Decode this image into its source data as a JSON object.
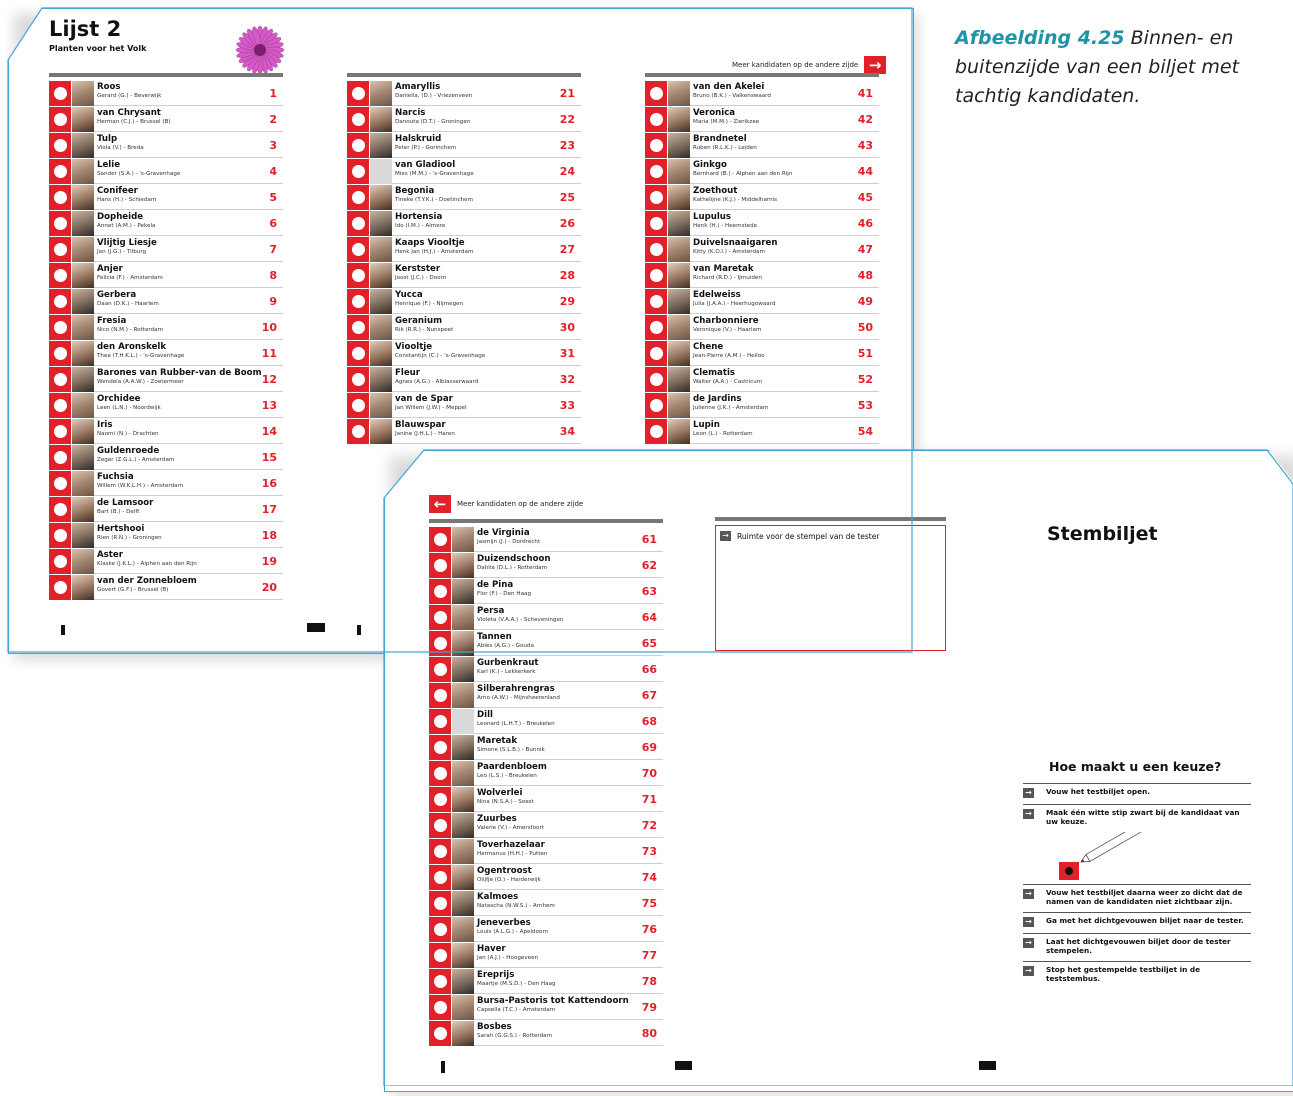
{
  "caption": {
    "label": "Afbeelding 4.25",
    "text": " Binnen- en buitenzijde van een biljet met tachtig kandidaten."
  },
  "back": {
    "list_title": "Lijst 2",
    "party_name": "Planten voor het Volk",
    "more_label": "Meer kandidaten op de andere zijde",
    "columns": [
      [
        {
          "name": "Roos",
          "sub": "Gerard (G.) - Beverwijk",
          "no": "1"
        },
        {
          "name": "van Chrysant",
          "sub": "Herman (C.J.) - Brussel (B)",
          "no": "2"
        },
        {
          "name": "Tulp",
          "sub": "Viola (V.) - Breda",
          "no": "3"
        },
        {
          "name": "Lelie",
          "sub": "Sander (S.A.) - 's-Gravenhage",
          "no": "4"
        },
        {
          "name": "Conifeer",
          "sub": "Hans (H.) - Schiedam",
          "no": "5"
        },
        {
          "name": "Dopheide",
          "sub": "Annet (A.M.) - Pekela",
          "no": "6"
        },
        {
          "name": "Vlijtig Liesje",
          "sub": "Jan (J.G.) - Tilburg",
          "no": "7"
        },
        {
          "name": "Anjer",
          "sub": "Felicia (F.) - Amsterdam",
          "no": "8"
        },
        {
          "name": "Gerbera",
          "sub": "Daan (D.K.) - Haarlem",
          "no": "9"
        },
        {
          "name": "Fresia",
          "sub": "Nico (N.M.) - Rotterdam",
          "no": "10"
        },
        {
          "name": "den Aronskelk",
          "sub": "Thea (T.H.K.L.) - 's-Gravenhage",
          "no": "11"
        },
        {
          "name": "Barones van Rubber-van de Boom",
          "sub": "Wendela (A.A.W.) - Zoetermeer",
          "no": "12"
        },
        {
          "name": "Orchidee",
          "sub": "Leen (L.N.) - Noordwijk",
          "no": "13"
        },
        {
          "name": "Iris",
          "sub": "Naomi (N.) - Drachten",
          "no": "14"
        },
        {
          "name": "Guldenroede",
          "sub": "Zeger (Z.G.L.) - Amsterdam",
          "no": "15"
        },
        {
          "name": "Fuchsia",
          "sub": "Willem (W.K.L.H.) - Amsterdam",
          "no": "16"
        },
        {
          "name": "de Lamsoor",
          "sub": "Bart (B.) - Delft",
          "no": "17"
        },
        {
          "name": "Hertshooi",
          "sub": "Rien (R.N.) - Groningen",
          "no": "18"
        },
        {
          "name": "Aster",
          "sub": "Klaske (J.K.L.) - Alphen aan den Rijn",
          "no": "19"
        },
        {
          "name": "van der Zonnebloem",
          "sub": "Govert (G.F.) - Brussel (B)",
          "no": "20"
        }
      ],
      [
        {
          "name": "Amaryllis",
          "sub": "Daniella, (D.) - Vriezenveen",
          "no": "21"
        },
        {
          "name": "Narcis",
          "sub": "Danouta (D.T.) - Groningen",
          "no": "22"
        },
        {
          "name": "Halskruid",
          "sub": "Peter (P.) - Gorinchem",
          "no": "23"
        },
        {
          "name": "van Gladiool",
          "sub": "Mies (M.M.) - 's-Gravenhage",
          "no": "24"
        },
        {
          "name": "Begonia",
          "sub": "Tineke (T.Y.K.) - Doetinchem",
          "no": "25"
        },
        {
          "name": "Hortensia",
          "sub": "Ido (I.M.) - Almere",
          "no": "26"
        },
        {
          "name": "Kaaps Viooltje",
          "sub": "Henk Jan (H.J.) - Amsterdam",
          "no": "27"
        },
        {
          "name": "Kerstster",
          "sub": "Joost (J.C.) - Doorn",
          "no": "28"
        },
        {
          "name": "Yucca",
          "sub": "Henrique (F.) - Nijmegen",
          "no": "29"
        },
        {
          "name": "Geranium",
          "sub": "Rik (R.R.) - Nunspeet",
          "no": "30"
        },
        {
          "name": "Viooltje",
          "sub": "Constantijn (C.) - 's-Gravenhage",
          "no": "31"
        },
        {
          "name": "Fleur",
          "sub": "Agnes (A.G.) - Alblasserwaard",
          "no": "32"
        },
        {
          "name": "van de Spar",
          "sub": "Jan Willem (J.W.) - Meppel",
          "no": "33"
        },
        {
          "name": "Blauwspar",
          "sub": "Janine (J.H.L.) - Haren",
          "no": "34"
        }
      ],
      [
        {
          "name": "van den Akelei",
          "sub": "Bruno (B.K.) - Valkenswaard",
          "no": "41"
        },
        {
          "name": "Veronica",
          "sub": "Maria (M.M.) - Zierikzee",
          "no": "42"
        },
        {
          "name": "Brandnetel",
          "sub": "Ruben (R.L.K.) - Leiden",
          "no": "43"
        },
        {
          "name": "Ginkgo",
          "sub": "Bernhard (B.) - Alphen aan den Rijn",
          "no": "44"
        },
        {
          "name": "Zoethout",
          "sub": "Kathelijne (K.J.) - Middelharnis",
          "no": "45"
        },
        {
          "name": "Lupulus",
          "sub": "Henk (H.) - Heemstede",
          "no": "46"
        },
        {
          "name": "Duivelsnaaigaren",
          "sub": "Kitty (K.O.I.) - Amsterdam",
          "no": "47"
        },
        {
          "name": "van Maretak",
          "sub": "Richard (R.D.) - IJmuiden",
          "no": "48"
        },
        {
          "name": "Edelweiss",
          "sub": "Julia (J.A.A.) - Heerhugowaard",
          "no": "49"
        },
        {
          "name": "Charbonniere",
          "sub": "Veronique (V.) - Haarlem",
          "no": "50"
        },
        {
          "name": "Chene",
          "sub": "Jean-Pierre (A.M.) - Heiloo",
          "no": "51"
        },
        {
          "name": "Clematis",
          "sub": "Walter (A.A.) - Castricum",
          "no": "52"
        },
        {
          "name": "de Jardins",
          "sub": "Julienne (J.K.) - Amsterdam",
          "no": "53"
        },
        {
          "name": "Lupin",
          "sub": "Leon (L.) - Rotterdam",
          "no": "54"
        }
      ]
    ]
  },
  "front": {
    "more_label": "Meer kandidaten op de andere zijde",
    "stamp_label": "Ruimte voor de stempel van de tester",
    "title": "Stembiljet",
    "how_title": "Hoe maakt u een keuze?",
    "steps": [
      "Vouw het testbiljet open.",
      "Maak één witte stip zwart bij de kandidaat van uw keuze.",
      "Vouw het testbiljet daarna weer zo dicht dat de namen van de kandidaten niet zichtbaar zijn.",
      "Ga met het dichtgevouwen biljet naar de tester.",
      "Laat het dichtgevouwen biljet door de tester stempelen.",
      "Stop het gestempelde testbiljet in de teststembus."
    ],
    "candidates": [
      {
        "name": "de Virginia",
        "sub": "Jasmijn (J.) - Dordrecht",
        "no": "61"
      },
      {
        "name": "Duizendschoon",
        "sub": "Dahlia (D.L.) - Rotterdam",
        "no": "62"
      },
      {
        "name": "de Pina",
        "sub": "Flor (F.) - Den Haag",
        "no": "63"
      },
      {
        "name": "Persa",
        "sub": "Violeta (V.A.A.) - Scheveningen",
        "no": "64"
      },
      {
        "name": "Tannen",
        "sub": "Abies (A.G.) - Gouda",
        "no": "65"
      },
      {
        "name": "Gurbenkraut",
        "sub": "Karl (K.) - Lekkerkerk",
        "no": "66"
      },
      {
        "name": "Silberahrengras",
        "sub": "Arno (A.W.) - Mijnsheerenland",
        "no": "67"
      },
      {
        "name": "Dill",
        "sub": "Leonard (L.H.T.) - Breukelen",
        "no": "68"
      },
      {
        "name": "Maretak",
        "sub": "Simone (S.L.B.) - Bunnik",
        "no": "69"
      },
      {
        "name": "Paardenbloem",
        "sub": "Leo (L.S.) - Breukelen",
        "no": "70"
      },
      {
        "name": "Wolverlei",
        "sub": "Nina (N.S.A.) - Soest",
        "no": "71"
      },
      {
        "name": "Zuurbes",
        "sub": "Valerie (V.) - Amersfoort",
        "no": "72"
      },
      {
        "name": "Toverhazelaar",
        "sub": "Hermanus (H.H.) - Putten",
        "no": "73"
      },
      {
        "name": "Ogentroost",
        "sub": "Olijfje (O.) - Harderwijk",
        "no": "74"
      },
      {
        "name": "Kalmoes",
        "sub": "Natascha (N.W.S.) - Arnhem",
        "no": "75"
      },
      {
        "name": "Jeneverbes",
        "sub": "Louis (A.L.G.) - Apeldoorn",
        "no": "76"
      },
      {
        "name": "Haver",
        "sub": "Jan (A.J.) - Hoogeveen",
        "no": "77"
      },
      {
        "name": "Ereprijs",
        "sub": "Maartje (M.S.D.) - Den Haag",
        "no": "78"
      },
      {
        "name": "Bursa-Pastoris tot Kattendoorn",
        "sub": "Capsella (T.C.) - Amsterdam",
        "no": "79"
      },
      {
        "name": "Bosbes",
        "sub": "Sarah (G.G.S.) - Rotterdam",
        "no": "80"
      }
    ]
  },
  "colors": {
    "accent": "#e2202a",
    "sheet_border": "#3fa7d6",
    "caption_label": "#1f93a8"
  }
}
